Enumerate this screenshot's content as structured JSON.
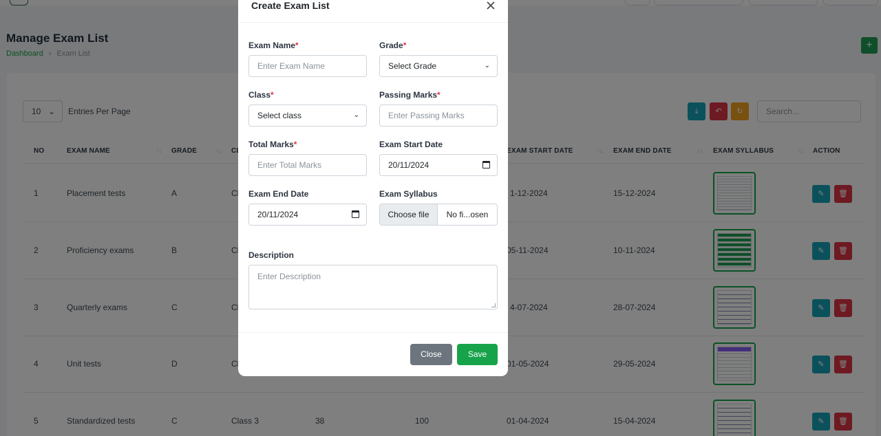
{
  "page": {
    "title": "Manage Exam List",
    "breadcrumb": {
      "home": "Dashboard",
      "current": "Exam List"
    },
    "add_button": "+"
  },
  "table_controls": {
    "entries_value": "10",
    "entries_label": "Entries Per Page",
    "search_placeholder": "Search..."
  },
  "table": {
    "headers": [
      "NO",
      "EXAM NAME",
      "GRADE",
      "CL",
      "EXAM START DATE",
      "EXAM END DATE",
      "EXAM SYLLABUS",
      "ACTION"
    ],
    "rows": [
      {
        "no": "1",
        "name": "Placement tests",
        "grade": "A",
        "class": "Cl",
        "start": "1-12-2024",
        "end": "15-12-2024"
      },
      {
        "no": "2",
        "name": "Proficiency exams",
        "grade": "B",
        "class": "Cl",
        "start": "05-11-2024",
        "end": "10-11-2024"
      },
      {
        "no": "3",
        "name": "Quarterly exams",
        "grade": "C",
        "class": "Cl",
        "start": "4-07-2024",
        "end": "28-07-2024"
      },
      {
        "no": "4",
        "name": "Unit tests",
        "grade": "D",
        "class": "Cl",
        "start": "01-05-2024",
        "end": "29-05-2024"
      },
      {
        "no": "5",
        "name": "Standardized tests",
        "grade": "C",
        "class": "Class 3",
        "passing": "38",
        "total": "100",
        "start": "01-04-2024",
        "end": "15-04-2024"
      }
    ]
  },
  "modal": {
    "title": "Create Exam List",
    "exam_name": {
      "label": "Exam Name",
      "placeholder": "Enter Exam Name"
    },
    "grade": {
      "label": "Grade",
      "value": "Select Grade"
    },
    "class": {
      "label": "Class",
      "value": "Select class"
    },
    "passing_marks": {
      "label": "Passing Marks",
      "placeholder": "Enter Passing Marks"
    },
    "total_marks": {
      "label": "Total Marks",
      "placeholder": "Enter Total Marks"
    },
    "start_date": {
      "label": "Exam Start Date",
      "value": "20/11/2024"
    },
    "end_date": {
      "label": "Exam End Date",
      "value": "20/11/2024"
    },
    "syllabus": {
      "label": "Exam Syllabus",
      "button": "Choose file",
      "status": "No fi...osen"
    },
    "description": {
      "label": "Description",
      "placeholder": "Enter Description"
    },
    "required_mark": "*",
    "close_button": "Close",
    "save_button": "Save"
  },
  "colors": {
    "accent": "#16a34a",
    "edit": "#17a2b8",
    "delete": "#dc3545",
    "neutral": "#6c757d"
  }
}
